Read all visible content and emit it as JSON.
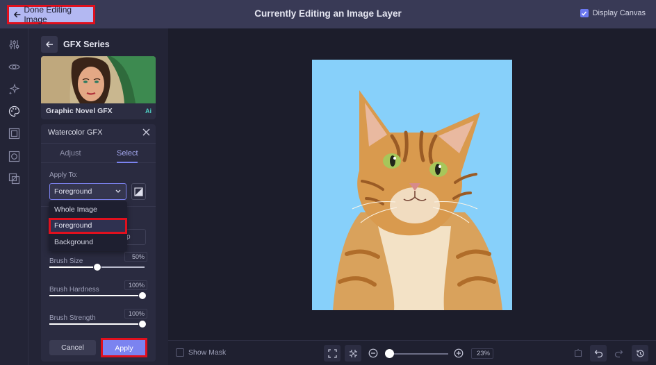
{
  "topbar": {
    "done_label": "Done Editing Image",
    "title": "Currently Editing an Image Layer",
    "display_canvas_label": "Display Canvas",
    "display_canvas_checked": true
  },
  "rail": {
    "icons": [
      "sliders-icon",
      "eye-icon",
      "sparkles-icon",
      "palette-icon",
      "frame-icon",
      "crop-frame-icon",
      "layers-icon"
    ]
  },
  "panel": {
    "title": "GFX Series",
    "thumbnail_label": "Graphic Novel GFX",
    "ai_badge": "Ai",
    "effect_title": "Watercolor GFX",
    "tabs": [
      {
        "label": "Adjust",
        "active": false
      },
      {
        "label": "Select",
        "active": true
      }
    ],
    "apply_to_label": "Apply To:",
    "apply_to_value": "Foreground",
    "dropdown_options": [
      "Whole Image",
      "Foreground",
      "Background"
    ],
    "dropdown_highlighted": "Foreground",
    "hidden_field_fragment": "p",
    "sliders": [
      {
        "label": "Brush Size",
        "value_text": "50%",
        "value": 0.5
      },
      {
        "label": "Brush Hardness",
        "value_text": "100%",
        "value": 1.0
      },
      {
        "label": "Brush Strength",
        "value_text": "100%",
        "value": 1.0
      }
    ],
    "cancel_label": "Cancel",
    "apply_label": "Apply"
  },
  "canvas": {
    "background_color": "#87d0fa",
    "subject": "watercolor cat portrait"
  },
  "bottombar": {
    "show_mask_label": "Show Mask",
    "show_mask_checked": false,
    "zoom_value": "23%",
    "zoom_fraction": 0.0
  },
  "colors": {
    "accent": "#7b83f0",
    "highlight_outline": "#e0101e",
    "topbar": "#393a56",
    "panel": "#232436"
  }
}
